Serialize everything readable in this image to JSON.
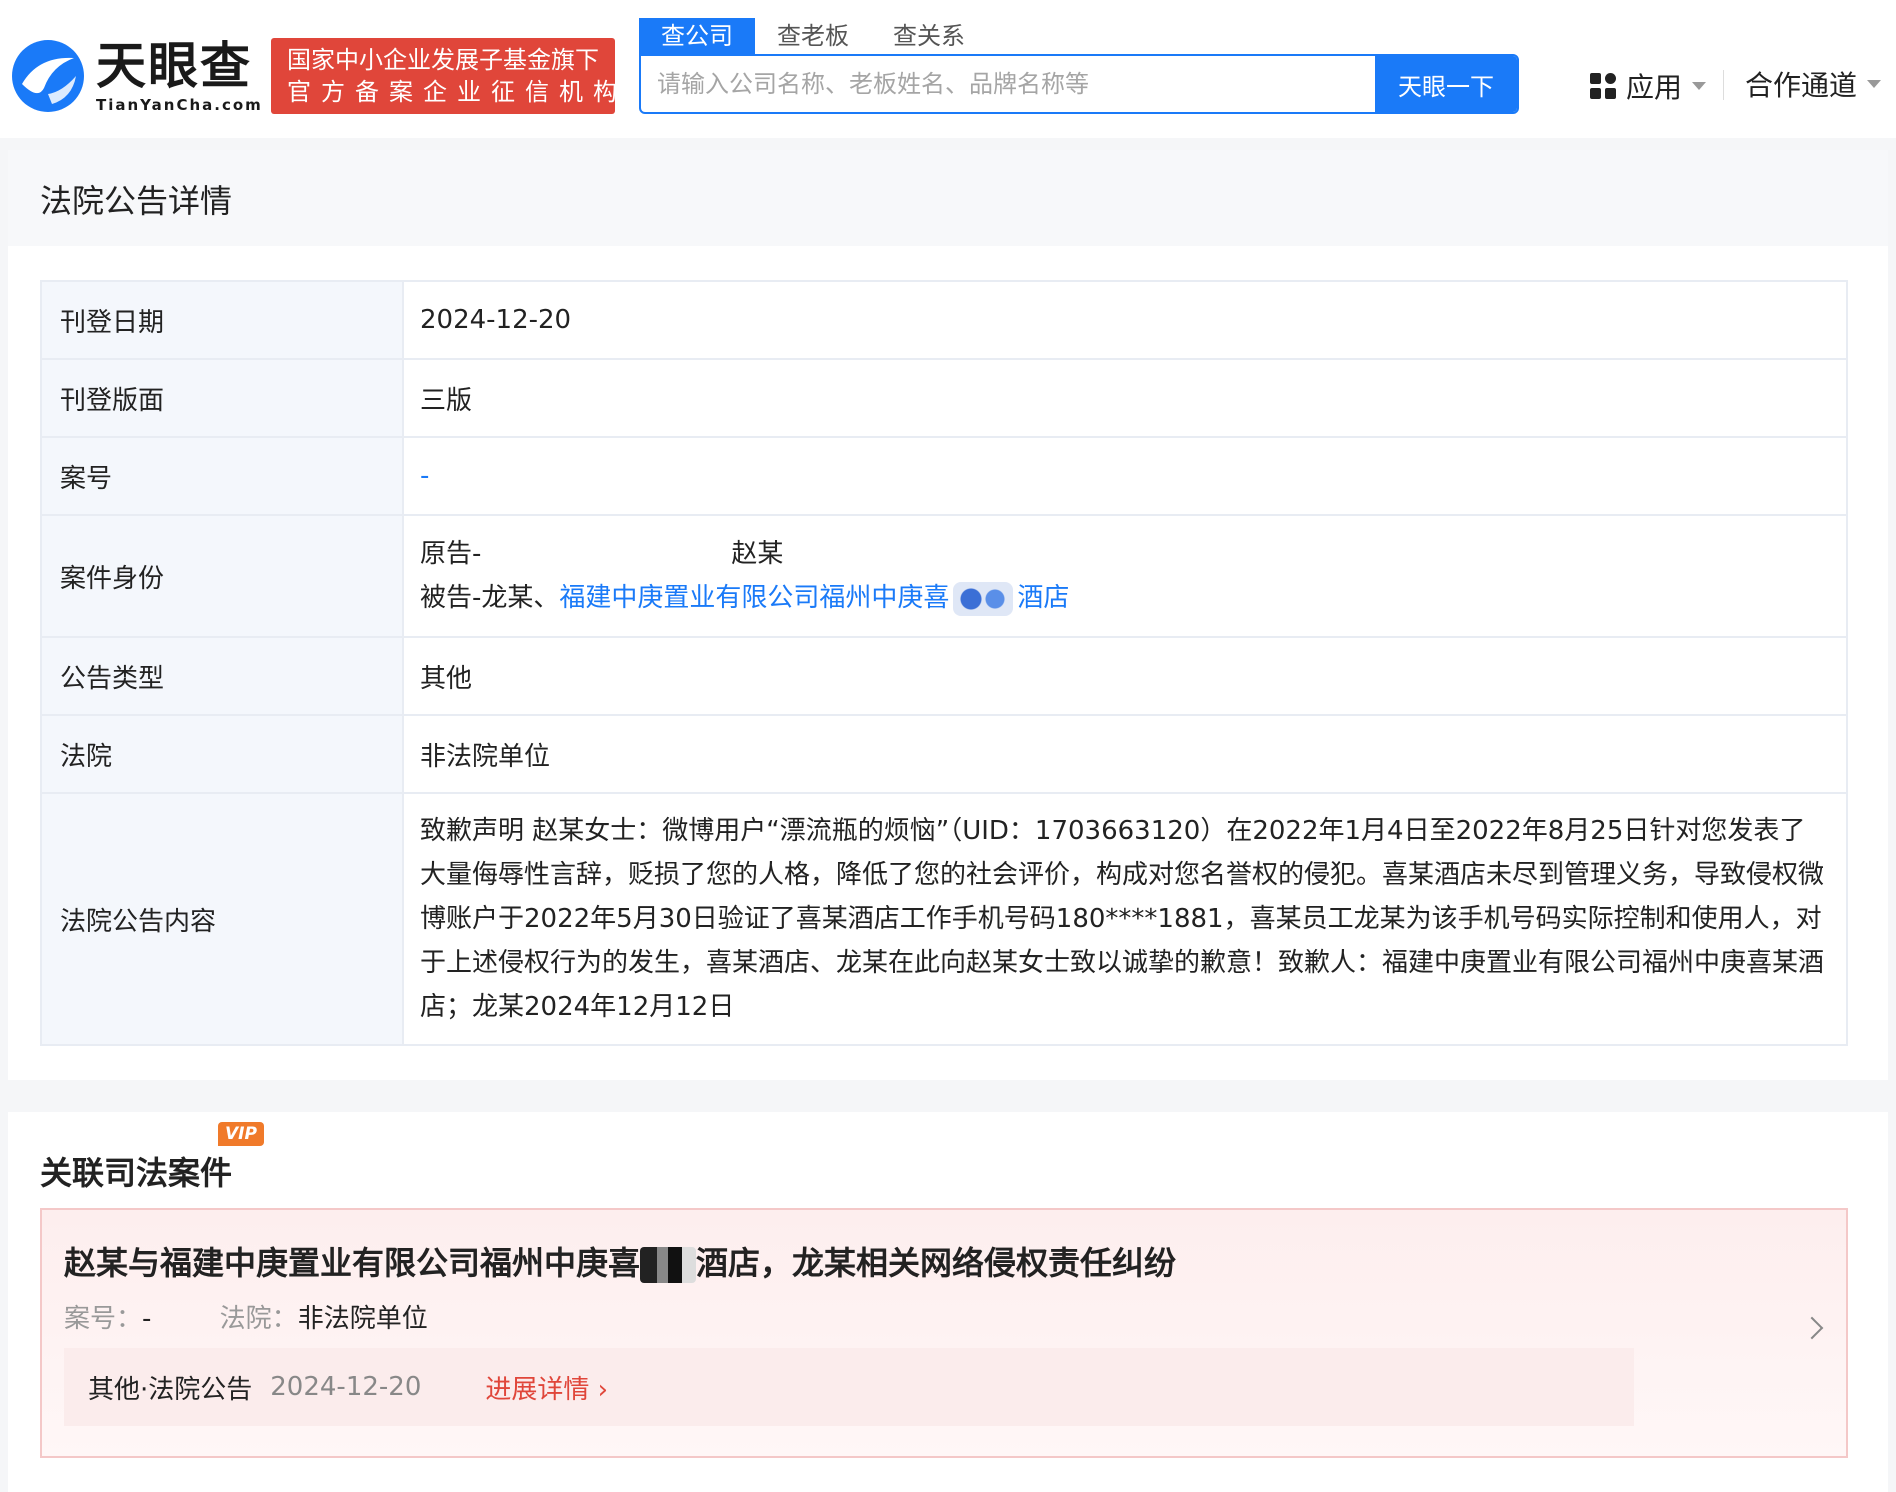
{
  "header": {
    "logo_cn": "天眼查",
    "logo_en": "TianYanCha.com",
    "badge_line1": "国家中小企业发展子基金旗下",
    "badge_line2": "官方备案企业征信机构",
    "tabs": [
      "查公司",
      "查老板",
      "查关系"
    ],
    "search_placeholder": "请输入公司名称、老板姓名、品牌名称等",
    "search_button": "天眼一下",
    "apps_label": "应用",
    "coop_label": "合作通道"
  },
  "detail_card": {
    "title": "法院公告详情",
    "rows": {
      "publish_date_label": "刊登日期",
      "publish_date": "2024-12-20",
      "page_label": "刊登版面",
      "page": "三版",
      "case_no_label": "案号",
      "case_no": "-",
      "party_label": "案件身份",
      "plaintiff_prefix": "原告-",
      "plaintiff_name": "赵某",
      "defendant_prefix": "被告-龙某、",
      "defendant_link_a": "福建中庚置业有限公司福州中庚喜",
      "defendant_link_b": "酒店",
      "type_label": "公告类型",
      "type": "其他",
      "court_label": "法院",
      "court": "非法院单位",
      "content_label": "法院公告内容",
      "content": "致歉声明 赵某女士：微博用户“漂流瓶的烦恼”（UID：1703663120）在2022年1月4日至2022年8月25日针对您发表了大量侮辱性言辞，贬损了您的人格，降低了您的社会评价，构成对您名誉权的侵犯。喜某酒店未尽到管理义务，导致侵权微博账户于2022年5月30日验证了喜某酒店工作手机号码180****1881，喜某员工龙某为该手机号码实际控制和使用人，对于上述侵权行为的发生，喜某酒店、龙某在此向赵某女士致以诚挚的歉意！致歉人：福建中庚置业有限公司福州中庚喜某酒店；龙某2024年12月12日"
    }
  },
  "related_card": {
    "vip": "VIP",
    "title": "关联司法案件",
    "case_title_a": "赵某与福建中庚置业有限公司福州中庚喜",
    "case_title_b": "酒店，龙某相关网络侵权责任纠纷",
    "case_no_label": "案号：",
    "case_no": "-",
    "court_label": "法院：",
    "court": "非法院单位",
    "foot_type": "其他·法院公告",
    "foot_date": "2024-12-20",
    "foot_link": "进展详情"
  },
  "colors": {
    "accent": "#1a7af8",
    "badge_red": "#e0463a"
  }
}
